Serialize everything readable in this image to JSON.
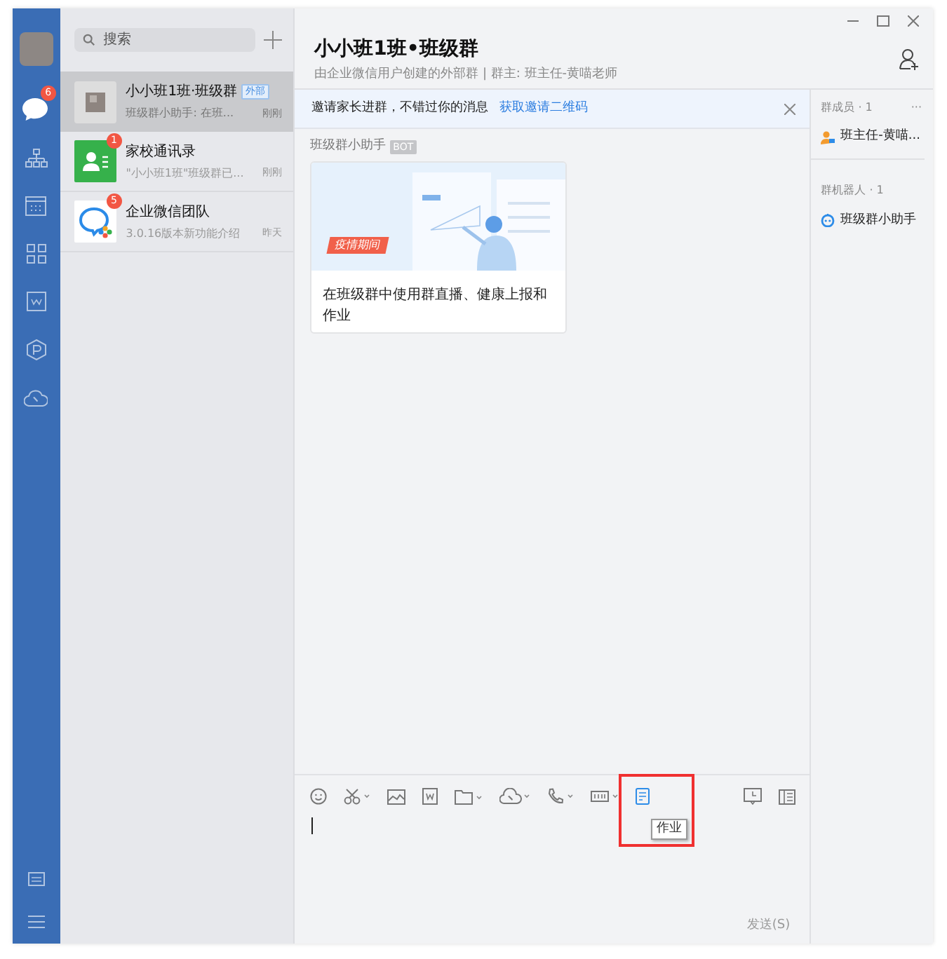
{
  "nav": {
    "items": [
      {
        "kind": "chat",
        "selected": true,
        "badge": "6"
      },
      {
        "kind": "org",
        "selected": false
      },
      {
        "kind": "calendar",
        "selected": false
      },
      {
        "kind": "apps",
        "selected": false
      },
      {
        "kind": "doc",
        "selected": false
      },
      {
        "kind": "hexagon",
        "selected": false
      },
      {
        "kind": "cloud",
        "selected": false
      }
    ],
    "bottom": [
      {
        "kind": "settings-box",
        "selected": false
      },
      {
        "kind": "menu",
        "selected": false
      }
    ]
  },
  "search": {
    "placeholder": "搜索"
  },
  "conversations": [
    {
      "kind": "group",
      "name": "小小班1班·班级群",
      "tag": "外部",
      "preview": "班级群小助手: 在班...",
      "time": "刚刚",
      "selected": true
    },
    {
      "kind": "contacts",
      "name": "家校通讯录",
      "badge": "1",
      "preview": "\"小小班1班\"班级群已...",
      "time": "刚刚",
      "selected": false
    },
    {
      "kind": "team",
      "name": "企业微信团队",
      "badge": "5",
      "preview": "3.0.16版本新功能介绍",
      "time": "昨天",
      "selected": false
    }
  ],
  "chat": {
    "title": "小小班1班•班级群",
    "subtitle": "由企业微信用户创建的外部群 | 群主: 班主任-黄喵老师"
  },
  "banner": {
    "text": "邀请家长进群，不错过你的消息",
    "link": "获取邀请二维码"
  },
  "message": {
    "sender": "班级群小助手",
    "sender_tag": "BOT",
    "card": {
      "tag": "疫情期间",
      "text": "在班级群中使用群直播、健康上报和作业"
    }
  },
  "members": {
    "heading": "群成员 · 1",
    "more": "···",
    "items": [
      {
        "name": "班主任-黄喵..."
      }
    ]
  },
  "robots": {
    "heading": "群机器人 · 1",
    "items": [
      {
        "name": "班级群小助手"
      }
    ]
  },
  "composer": {
    "tooltip": "作业",
    "send": "发送(S)"
  }
}
